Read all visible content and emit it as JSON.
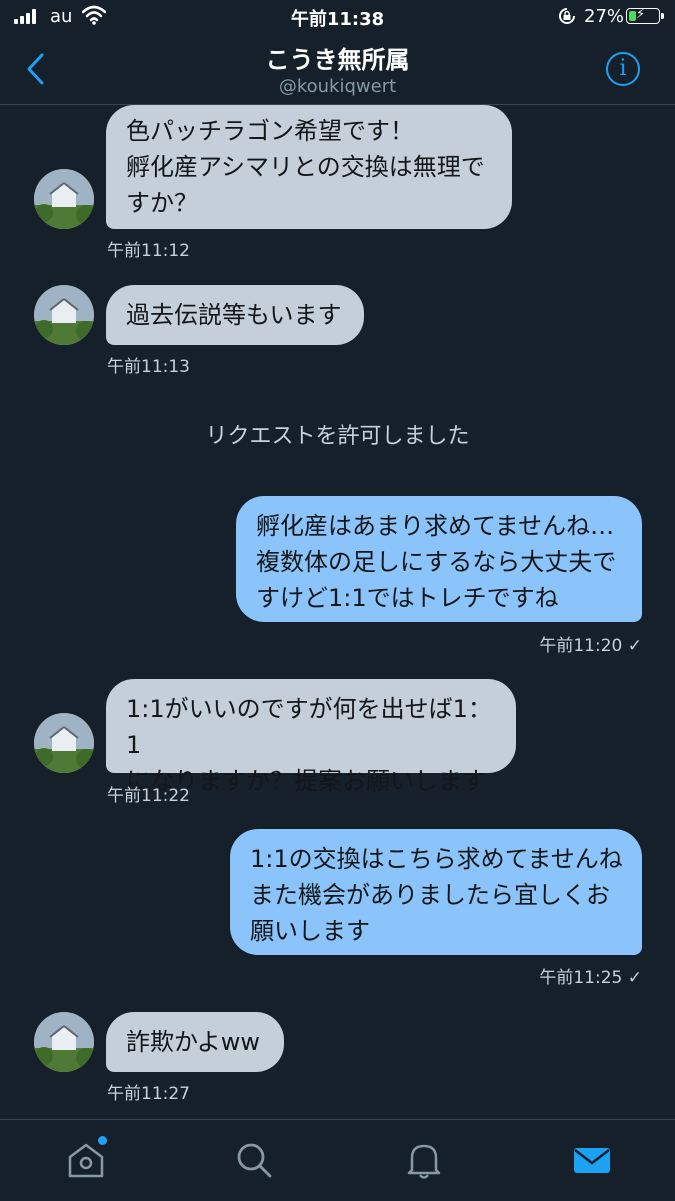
{
  "status_bar": {
    "carrier": "au",
    "time": "午前11:38",
    "battery": "27%"
  },
  "header": {
    "name": "こうき無所属",
    "handle": "@koukiqwert"
  },
  "messages": [
    {
      "line1": "色パッチラゴン希望です！",
      "line2": "孵化産アシマリとの交換は無理で",
      "line3": "すか？",
      "time": "午前11:12"
    },
    {
      "line1": "過去伝説等もいます",
      "time": "午前11:13"
    },
    {
      "notice": "リクエストを許可しました"
    },
    {
      "line1": "孵化産はあまり求めてませんね…",
      "line2": "複数体の足しにするなら大丈夫で",
      "line3": "すけど1:1ではトレチですね",
      "time": "午前11:20 ✓"
    },
    {
      "line1": "1:1がいいのですが何を出せば1：1",
      "line2": "になりますか？提案お願いします",
      "time": "午前11:22"
    },
    {
      "line1": "1:1の交換はこちら求めてませんね",
      "line2": "また機会がありましたら宜しくお",
      "line3": "願いします",
      "time": "午前11:25 ✓"
    },
    {
      "line1": "詐欺かよww",
      "time": "午前11:27"
    }
  ],
  "colors": {
    "background": "#15202b",
    "incoming_bubble": "#c4cfd9",
    "outgoing_bubble": "#8ac4fa",
    "accent": "#1da1f2"
  },
  "tabbar": {
    "icons": [
      "home-icon",
      "search-icon",
      "notifications-icon",
      "messages-icon"
    ],
    "active": "messages-icon"
  }
}
